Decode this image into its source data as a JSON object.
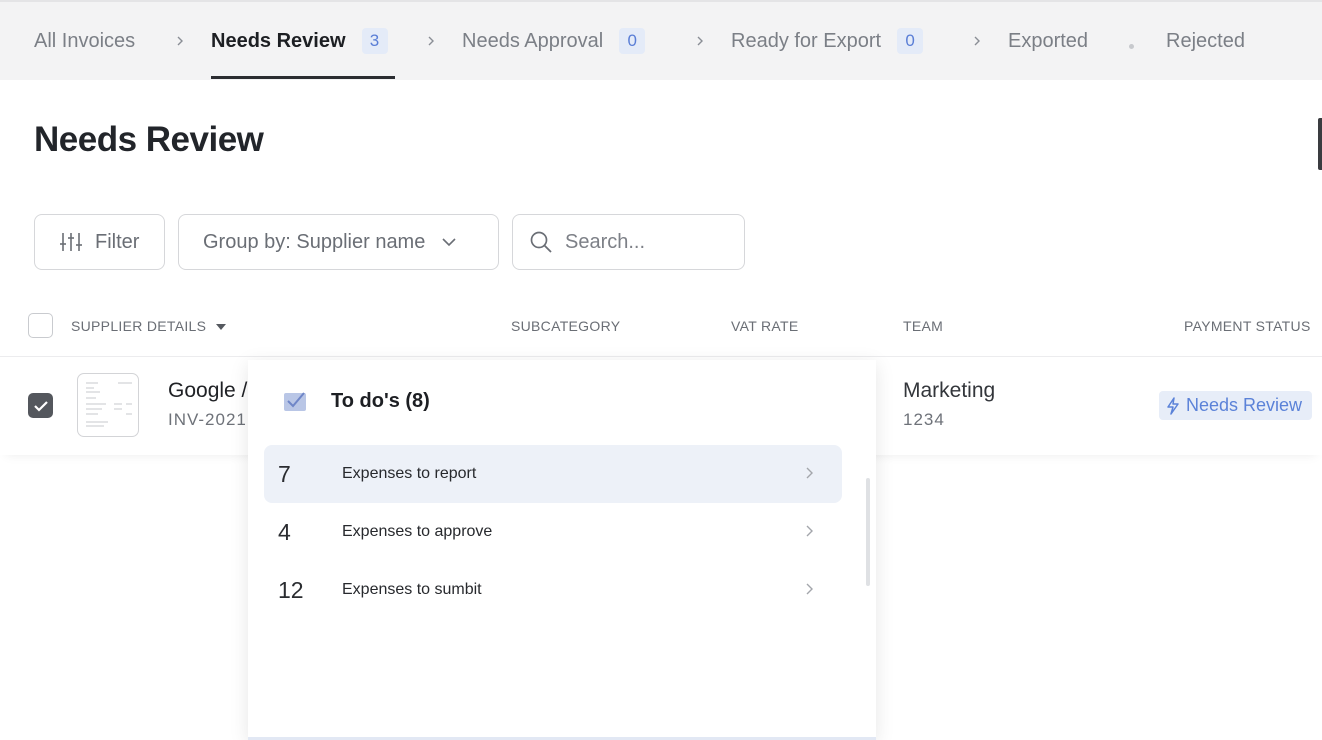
{
  "tabs": [
    {
      "label": "All Invoices",
      "count": null
    },
    {
      "label": "Needs Review",
      "count": "3",
      "active": true
    },
    {
      "label": "Needs Approval",
      "count": "0"
    },
    {
      "label": "Ready for Export",
      "count": "0"
    },
    {
      "label": "Exported",
      "count": null
    },
    {
      "label": "Rejected",
      "count": null
    }
  ],
  "page": {
    "title": "Needs Review"
  },
  "toolbar": {
    "filter_label": "Filter",
    "group_by_label": "Group by: Supplier name",
    "search_placeholder": "Search..."
  },
  "table": {
    "columns": [
      "SUPPLIER DETAILS",
      "SUBCATEGORY",
      "VAT RATE",
      "TEAM",
      "PAYMENT STATUS"
    ],
    "rows": [
      {
        "supplier": "Google /",
        "invoice": "INV-2021",
        "team": "Marketing",
        "team_code": "1234",
        "status": "Needs Review",
        "checked": true
      }
    ]
  },
  "todo_popup": {
    "title": "To do's (8)",
    "items": [
      {
        "count": "7",
        "label": "Expenses to report"
      },
      {
        "count": "4",
        "label": "Expenses to approve"
      },
      {
        "count": "12",
        "label": "Expenses to sumbit"
      }
    ]
  },
  "colors": {
    "accent_blue": "#5b82d8",
    "badge_bg": "#e4ebf8",
    "tab_bar_bg": "#f3f3f4",
    "checkbox_checked": "#54575d"
  },
  "icons": [
    "chevron-right-icon",
    "sliders-icon",
    "chevron-down-icon",
    "search-icon",
    "checkmark-icon",
    "document-thumbnail",
    "lightning-icon",
    "todo-icon"
  ]
}
